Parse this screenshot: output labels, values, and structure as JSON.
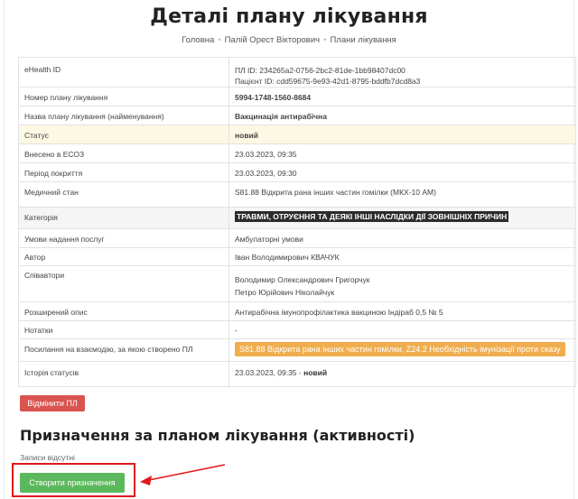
{
  "page": {
    "title": "Деталі плану лікування"
  },
  "breadcrumb": {
    "home": "Головна",
    "patient": "Палій Орест Вікторович",
    "plans": "Плани лікування"
  },
  "details": {
    "ehealth_id": {
      "label": "eHealth ID",
      "plan_id": "ПЛ ID: 234265a2-0756-2bc2-81de-1bb98407dc00",
      "patient_id": "Пацієнт ID: cdd59675-9e93-42d1-8795-bddfb7dcd8a3"
    },
    "number": {
      "label": "Номер плану лікування",
      "value": "5994-1748-1560-8684"
    },
    "name": {
      "label": "Назва плану лікування (найменування)",
      "value": "Вакцинація антирабічна"
    },
    "status": {
      "label": "Статус",
      "value": "новий"
    },
    "entered": {
      "label": "Внесено в ЕСОЗ",
      "value": "23.03.2023, 09:35"
    },
    "period": {
      "label": "Період покриття",
      "value": "23.03.2023, 09:30"
    },
    "condition": {
      "label": "Медичний стан",
      "value": "S81.88 Відкрита рана інших частин гомілки (МКХ-10 АМ)"
    },
    "category": {
      "label": "Категорія",
      "value": "ТРАВМИ, ОТРУЄННЯ ТА ДЕЯКІ ІНШІ НАСЛІДКИ ДІЇ ЗОВНІШНІХ ПРИЧИН"
    },
    "terms": {
      "label": "Умови надання послуг",
      "value": "Амбулаторні умови"
    },
    "author": {
      "label": "Автор",
      "value": "Іван Володимирович КВАЧУК"
    },
    "coauthors": {
      "label": "Співавтори",
      "values": [
        "Володимир Олександрович Григорчук",
        "Петро Юрійович Ніколайчук"
      ]
    },
    "description": {
      "label": "Розширений опис",
      "value": "Антирабічна імунопрофілактика вакциною Індіраб 0,5 № 5"
    },
    "notes": {
      "label": "Нотатки",
      "value": "-"
    },
    "encounter": {
      "label": "Посилання на взаємодію, за якою створено ПЛ",
      "value": "S81.88 Відкрита рана інших частин гомілки, Z24.2 Необхідність імунізації проти сказу"
    },
    "history": {
      "label": "Історія статусів",
      "date": "23.03.2023, 09:35 -",
      "status": "новий"
    }
  },
  "buttons": {
    "cancel": "Відмінити ПЛ",
    "create": "Створити призначення"
  },
  "activities": {
    "title": "Призначення за планом лікування (активності)",
    "empty": "Записи відсутні"
  },
  "colors": {
    "danger": "#d9534f",
    "success": "#5cb85c",
    "warning": "#f0ad4e",
    "annotation": "#e0191d"
  }
}
